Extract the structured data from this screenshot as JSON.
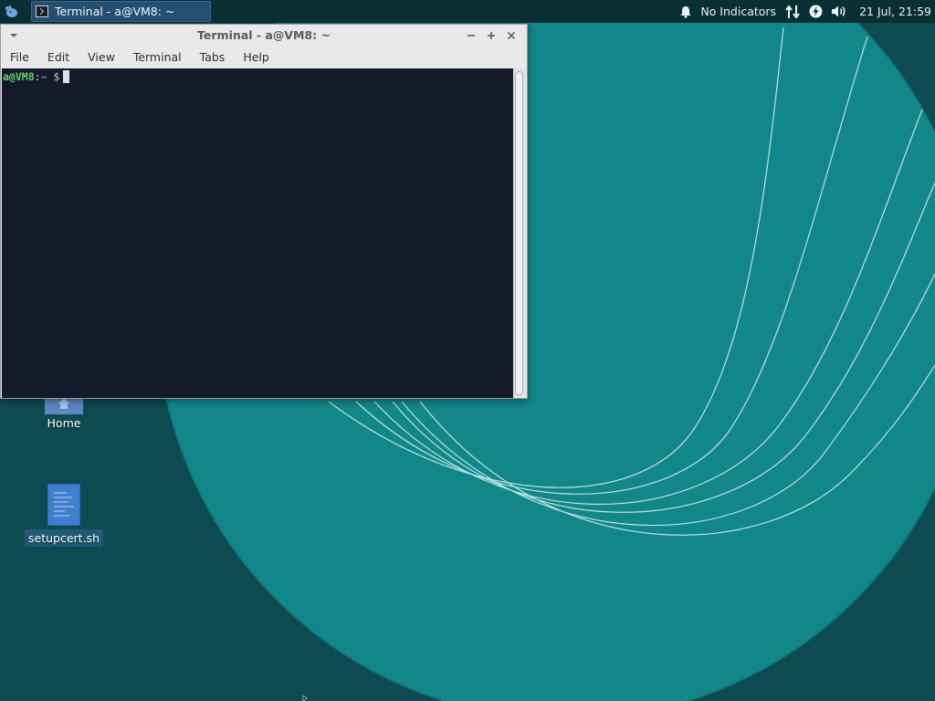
{
  "top_panel": {
    "taskbar_button_label": "Terminal - a@VM8: ~",
    "notifications_label": "No Indicators",
    "clock": "21 Jul, 21:59"
  },
  "terminal_window": {
    "title": "Terminal - a@VM8: ~",
    "menu": [
      "File",
      "Edit",
      "View",
      "Terminal",
      "Tabs",
      "Help"
    ],
    "prompt": {
      "user_host": "a@VM8",
      "separator": ":",
      "path": "~",
      "symbol": "$"
    }
  },
  "desktop_icons": {
    "home_label": "Home",
    "script_label": "setupcert.sh"
  },
  "colors": {
    "wallpaper_dark": "#0e4a52",
    "wallpaper_light": "#128a8c",
    "terminal_bg": "#141a2a",
    "prompt_user": "#6ad06a",
    "prompt_path": "#6c8ed6"
  },
  "icons": {
    "menu_button": "xfce-mouse-icon",
    "notifications": "bell-icon",
    "network": "network-arrows-icon",
    "power": "power-bolt-icon",
    "volume": "speaker-icon"
  }
}
